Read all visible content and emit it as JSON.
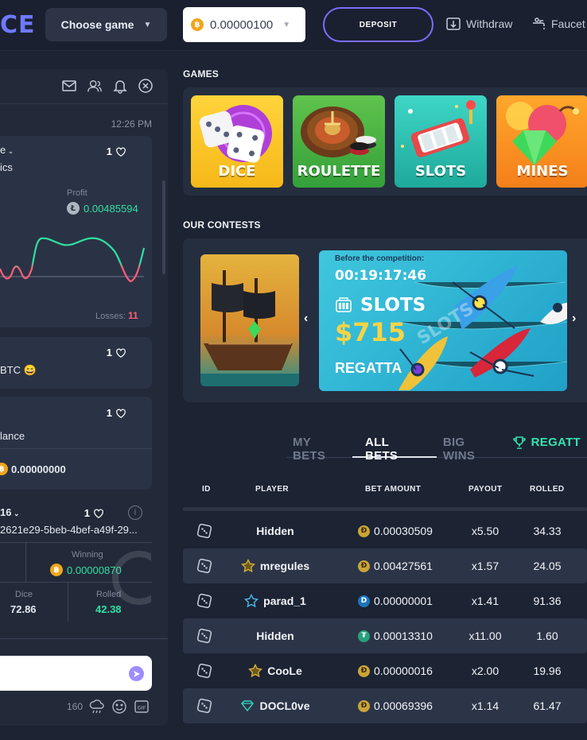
{
  "header": {
    "logo_fragment": "CE",
    "choose_game_label": "Choose game",
    "balance_value": "0.00000100",
    "balance_coin_symbol": "฿",
    "deposit_label": "DEPOSIT",
    "withdraw_label": "Withdraw",
    "faucet_label": "Faucet"
  },
  "chat": {
    "time": "12:26 PM",
    "messages": [
      {
        "user_fragment": "e",
        "likes": "1",
        "text_fragment": "ics",
        "profit_label": "Profit",
        "profit_value": "0.00485594",
        "losses_label": "Losses:",
        "losses_value": "11"
      },
      {
        "likes": "1",
        "text_fragment": "BTC 😄"
      },
      {
        "likes": "1",
        "text_fragment": "lance",
        "amount": "0.00000000"
      },
      {
        "user_fragment": "16",
        "likes": "1",
        "hash_fragment": "2621e29-5beb-4bef-a49f-29...",
        "winning_label": "Winning",
        "winning_value": "0.00000870",
        "dice_label": "Dice",
        "dice_value": "72.86",
        "rolled_label": "Rolled",
        "rolled_value": "42.38"
      }
    ],
    "char_count": "160"
  },
  "games": {
    "section_title": "GAMES",
    "items": [
      {
        "label": "DICE"
      },
      {
        "label": "ROULETTE"
      },
      {
        "label": "SLOTS"
      },
      {
        "label": "MINES"
      }
    ]
  },
  "contests": {
    "section_title": "OUR CONTESTS",
    "before_label": "Before the competition:",
    "countdown": "00:19:17:46",
    "game": "SLOTS",
    "prize": "$715",
    "name": "REGATTA",
    "watermark": "SLOTS"
  },
  "bets": {
    "tabs": [
      "MY BETS",
      "ALL BETS",
      "BIG WINS",
      "REGATT"
    ],
    "columns": [
      "ID",
      "PLAYER",
      "BET AMOUNT",
      "PAYOUT",
      "ROLLED"
    ],
    "rows": [
      {
        "player": "Hidden",
        "badge": "",
        "coin": "doge",
        "amount": "0.00030509",
        "payout": "x5.50",
        "rolled": "34.33"
      },
      {
        "player": "mregules",
        "badge": "star-gold",
        "coin": "doge",
        "amount": "0.00427561",
        "payout": "x1.57",
        "rolled": "24.05"
      },
      {
        "player": "parad_1",
        "badge": "star-blue",
        "coin": "dash",
        "amount": "0.00000001",
        "payout": "x1.41",
        "rolled": "91.36"
      },
      {
        "player": "Hidden",
        "badge": "",
        "coin": "tether",
        "amount": "0.00013310",
        "payout": "x11.00",
        "rolled": "1.60"
      },
      {
        "player": "CooLe",
        "badge": "star-gold",
        "coin": "doge",
        "amount": "0.00000016",
        "payout": "x2.00",
        "rolled": "19.96"
      },
      {
        "player": "DOCL0ve",
        "badge": "diamond",
        "coin": "doge",
        "amount": "0.00069396",
        "payout": "x1.14",
        "rolled": "61.47"
      }
    ]
  },
  "colors": {
    "accent": "#7c6dff",
    "positive": "#2fe0a2",
    "negative": "#ff5d7a",
    "btc": "#f2a51a",
    "doge": "#c9a43a",
    "dash": "#1c75bc",
    "tether": "#26a17b"
  }
}
